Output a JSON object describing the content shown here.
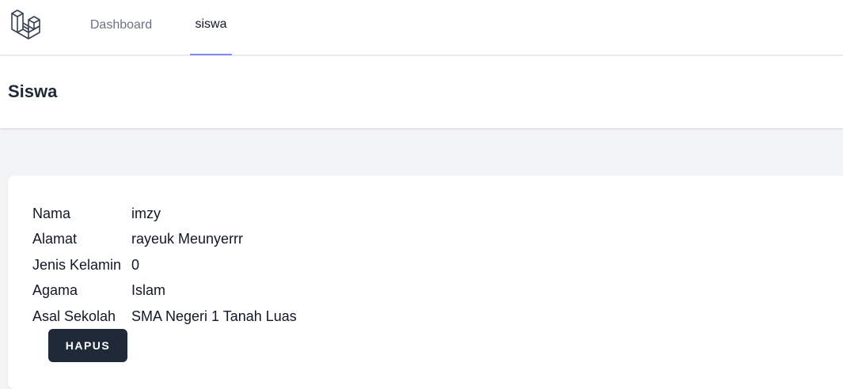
{
  "nav": {
    "logo_icon": "laravel-logo-icon",
    "links": [
      {
        "label": "Dashboard",
        "active": false
      },
      {
        "label": "siswa",
        "active": true
      }
    ]
  },
  "header": {
    "title": "Siswa"
  },
  "detail": {
    "rows": [
      {
        "label": "Nama",
        "value": "imzy"
      },
      {
        "label": "Alamat",
        "value": "rayeuk Meunyerrr"
      },
      {
        "label": "Jenis Kelamin",
        "value": "0"
      },
      {
        "label": "Agama",
        "value": "Islam"
      },
      {
        "label": "Asal Sekolah",
        "value": "SMA Negeri 1 Tanah Luas"
      }
    ]
  },
  "actions": {
    "delete_label": "HAPUS"
  },
  "colors": {
    "active_tab_underline": "#818cf8",
    "button_bg": "#1f2937",
    "page_bg": "#f3f4f6"
  }
}
